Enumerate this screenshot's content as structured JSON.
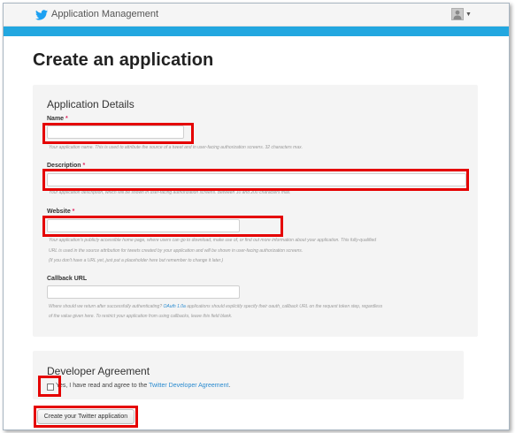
{
  "header": {
    "app_title": "Application Management"
  },
  "page": {
    "title": "Create an application"
  },
  "details": {
    "section_title": "Application Details",
    "name": {
      "label": "Name",
      "required_mark": "*",
      "value": "",
      "help": "Your application name. This is used to attribute the source of a tweet and in user-facing authorization screens. 32 characters max."
    },
    "description": {
      "label": "Description",
      "required_mark": "*",
      "value": "",
      "help": "Your application description, which will be shown in user-facing authorization screens. Between 10 and 200 characters max."
    },
    "website": {
      "label": "Website",
      "required_mark": "*",
      "value": "",
      "help_line1": "Your application's publicly accessible home page, where users can go to download, make use of, or find out more information about your application. This fully-qualified",
      "help_line2": "URL is used in the source attribution for tweets created by your application and will be shown in user-facing authorization screens.",
      "help_line3": "(If you don't have a URL yet, just put a placeholder here but remember to change it later.)"
    },
    "callback": {
      "label": "Callback URL",
      "value": "",
      "help_pre": "Where should we return after successfully authenticating?",
      "help_link": "OAuth 1.0a",
      "help_post": "applications should explicitly specify their oauth_callback URL on the request token step, regardless",
      "help_line2": "of the value given here. To restrict your application from using callbacks, leave this field blank."
    }
  },
  "agreement": {
    "section_title": "Developer Agreement",
    "checkbox_text": "Yes, I have read and agree to the",
    "link_text": "Twitter Developer Agreement",
    "link_suffix": ".",
    "checked": false
  },
  "submit": {
    "label": "Create your Twitter application"
  },
  "colors": {
    "brand_blue": "#22a7e0",
    "highlight": "#e50000",
    "required": "#e0245e"
  }
}
